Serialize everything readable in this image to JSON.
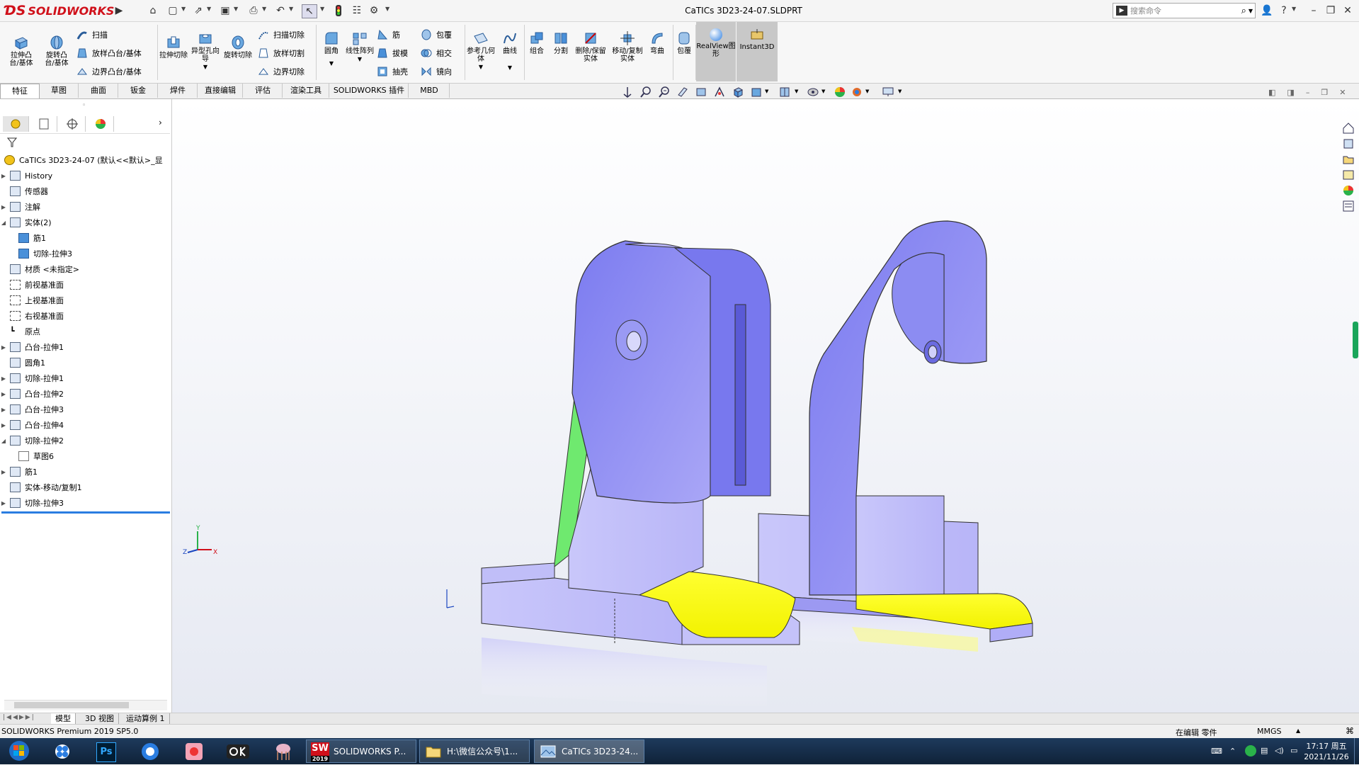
{
  "app": {
    "brand": "SOLIDWORKS",
    "doc_title": "CaTICs 3D23-24-07.SLDPRT",
    "search_placeholder": "搜索命令",
    "help": "?"
  },
  "command_manager": {
    "extrude_boss": "拉伸凸台/基体",
    "revolve_boss": "旋转凸台/基体",
    "sweep": "扫描",
    "loft_boss": "放样凸台/基体",
    "boundary_boss": "边界凸台/基体",
    "extrude_cut": "拉伸切除",
    "hole_wizard": "异型孔向导",
    "revolve_cut": "旋转切除",
    "swept_cut": "扫描切除",
    "lofted_cut": "放样切割",
    "boundary_cut": "边界切除",
    "fillet": "圆角",
    "linear_pattern": "线性阵列",
    "rib": "筋",
    "draft": "拔模",
    "shell": "抽壳",
    "wrap": "包覆",
    "intersect": "相交",
    "mirror": "镜向",
    "ref_geometry": "参考几何体",
    "curves": "曲线",
    "combine": "组合",
    "split": "分割",
    "delete_keep_body": "删除/保留实体",
    "move_copy_body": "移动/复制实体",
    "flex": "弯曲",
    "wrap2": "包覆",
    "realview": "RealView图形",
    "instant3d": "Instant3D"
  },
  "tabs": [
    "特征",
    "草图",
    "曲面",
    "钣金",
    "焊件",
    "直接编辑",
    "评估",
    "渲染工具",
    "SOLIDWORKS 插件",
    "MBD"
  ],
  "tree": {
    "root": "CaTICs 3D23-24-07  (默认<<默认>_显",
    "items": [
      {
        "label": "History"
      },
      {
        "label": "传感器"
      },
      {
        "label": "注解"
      },
      {
        "label": "实体(2)"
      },
      {
        "label": "筋1"
      },
      {
        "label": "切除-拉伸3"
      },
      {
        "label": "材质 <未指定>"
      },
      {
        "label": "前视基准面"
      },
      {
        "label": "上视基准面"
      },
      {
        "label": "右视基准面"
      },
      {
        "label": "原点"
      },
      {
        "label": "凸台-拉伸1"
      },
      {
        "label": "圆角1"
      },
      {
        "label": "切除-拉伸1"
      },
      {
        "label": "凸台-拉伸2"
      },
      {
        "label": "凸台-拉伸3"
      },
      {
        "label": "凸台-拉伸4"
      },
      {
        "label": "切除-拉伸2"
      },
      {
        "label": "草图6"
      },
      {
        "label": "筋1"
      },
      {
        "label": "实体-移动/复制1"
      },
      {
        "label": "切除-拉伸3"
      }
    ]
  },
  "triad": {
    "x": "X",
    "y": "Y",
    "z": "Z"
  },
  "model_tabs": [
    "模型",
    "3D 视图",
    "运动算例 1"
  ],
  "status": {
    "product": "SOLIDWORKS Premium 2019 SP5.0",
    "mode": "在编辑 零件",
    "units": "MMGS"
  },
  "taskbar": {
    "sw_task": "SOLIDWORKS P...",
    "sw_badge": "2019",
    "folder_task": "H:\\微信公众号\\1...",
    "doc_task": "CaTICs 3D23-24...",
    "ps_label": "Ps",
    "time": "17:17 周五",
    "date": "2021/11/26"
  },
  "colors": {
    "part_blue": "#8f8fef",
    "face_yellow": "#ffff20",
    "face_green": "#6fe96f",
    "brand_red": "#d0101a"
  }
}
